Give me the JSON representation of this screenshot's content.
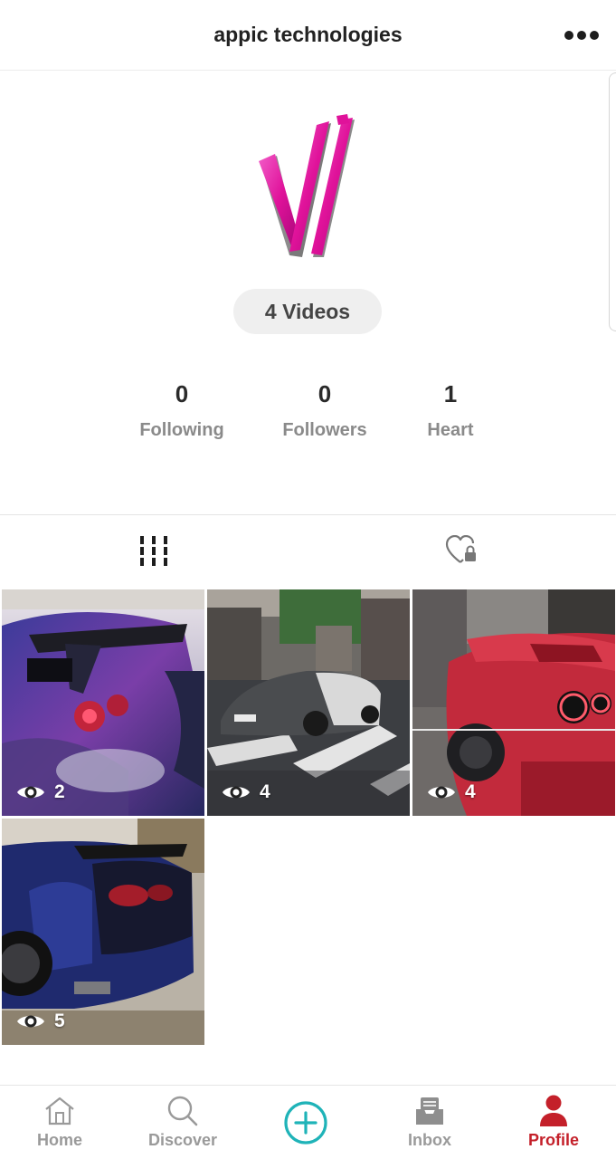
{
  "header": {
    "title": "appic technologies",
    "more_icon": "more-dots-icon"
  },
  "profile": {
    "avatar_icon": "appic-logo",
    "videos_label": "4 Videos",
    "stats": [
      {
        "value": "0",
        "label": "Following"
      },
      {
        "value": "0",
        "label": "Followers"
      },
      {
        "value": "1",
        "label": "Heart"
      }
    ]
  },
  "tabs": [
    {
      "name": "videos",
      "icon": "grid-bars-icon",
      "active": true
    },
    {
      "name": "liked",
      "icon": "heart-lock-icon",
      "active": false
    }
  ],
  "videos": [
    {
      "views": "2",
      "icon": "eye-icon"
    },
    {
      "views": "4",
      "icon": "eye-icon"
    },
    {
      "views": "4",
      "icon": "eye-icon"
    },
    {
      "views": "5",
      "icon": "eye-icon"
    }
  ],
  "bottom_nav": [
    {
      "label": "Home",
      "icon": "home-icon",
      "active": false
    },
    {
      "label": "Discover",
      "icon": "search-icon",
      "active": false
    },
    {
      "label": "",
      "icon": "add-circle-icon",
      "active": false
    },
    {
      "label": "Inbox",
      "icon": "inbox-icon",
      "active": false
    },
    {
      "label": "Profile",
      "icon": "person-icon",
      "active": true
    }
  ],
  "colors": {
    "accent": "#c4202a",
    "create_button": "#1fb3b8",
    "logo_magenta": "#e0129a"
  }
}
